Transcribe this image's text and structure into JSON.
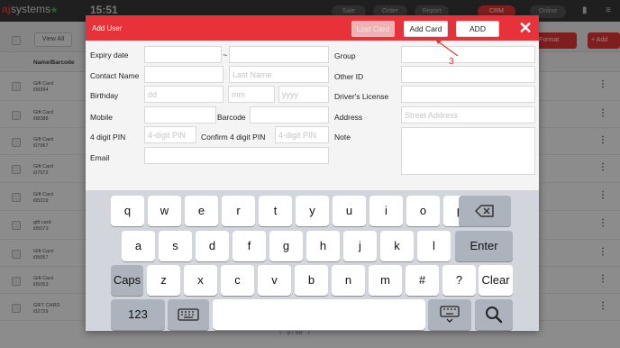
{
  "app": {
    "logo_prefix": "aj",
    "logo_text": "systems",
    "time": "15:51",
    "tabs": [
      "Sale",
      "Order",
      "Report",
      "CRM",
      "Online"
    ],
    "active_tab": "CRM"
  },
  "toolbar": {
    "view_all": "View All",
    "print_card": "Format Card",
    "add": "Add"
  },
  "table": {
    "header": "Name/Barcode",
    "rows": [
      {
        "name": "Gift Card",
        "code": "i08394"
      },
      {
        "name": "Gift Card",
        "code": "i08388"
      },
      {
        "name": "Gift Card",
        "code": "i07967"
      },
      {
        "name": "Gift Card",
        "code": "i07572"
      },
      {
        "name": "Gift Card",
        "code": "i05219"
      },
      {
        "name": "gift card",
        "code": "i05073"
      },
      {
        "name": "Gift Card",
        "code": "i05057"
      },
      {
        "name": "Gift Card",
        "code": "i05053"
      },
      {
        "name": "GIFT CARD",
        "code": "i02729"
      }
    ],
    "pager": "9 / 69"
  },
  "dialog": {
    "title": "Add User",
    "lost_card": "Lost Card",
    "add_card": "Add Card",
    "add": "ADD",
    "fields": {
      "expiry_label": "Expiry date",
      "tilde": "~",
      "contact_label": "Contact Name",
      "last_name_ph": "Last Name",
      "birthday_label": "Birthday",
      "dd_ph": "dd",
      "mm_ph": "mm",
      "yyyy_ph": "yyyy",
      "mobile_label": "Mobile",
      "barcode_label": "Barcode",
      "pin_label": "4 digit PIN",
      "pin_ph": "4-digit PIN",
      "confirm_label": "Confirm 4 digit PIN",
      "confirm_ph": "4-digit PIN",
      "email_label": "Email",
      "group_label": "Group",
      "other_id_label": "Other ID",
      "license_label": "Driver's License",
      "address_label": "Address",
      "address_ph": "Street Address",
      "note_label": "Note"
    }
  },
  "keyboard": {
    "row1": [
      "q",
      "w",
      "e",
      "r",
      "t",
      "y",
      "u",
      "i",
      "o",
      "p"
    ],
    "row2": [
      "a",
      "s",
      "d",
      "f",
      "g",
      "h",
      "j",
      "k",
      "l"
    ],
    "row3": [
      "z",
      "x",
      "c",
      "v",
      "b",
      "n",
      "m",
      "#",
      "?"
    ],
    "enter": "Enter",
    "caps": "Caps",
    "clear": "Clear",
    "num": "123"
  },
  "annotation": "3",
  "colors": {
    "accent": "#e8323a",
    "keyboard_bg": "#d3d5dc",
    "annotation": "#e53935"
  }
}
